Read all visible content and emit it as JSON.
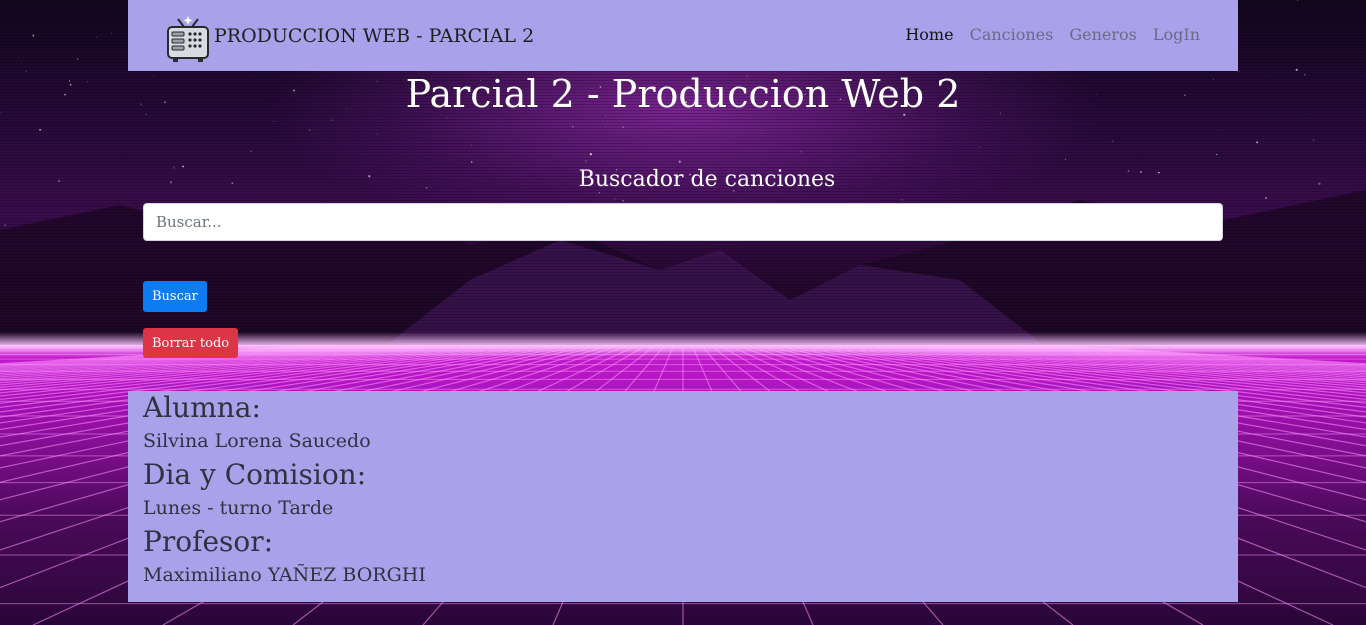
{
  "navbar": {
    "brand": "PRODUCCION WEB - PARCIAL 2",
    "logo_icon": "retro-tv-icon",
    "links": [
      {
        "label": "Home",
        "active": true
      },
      {
        "label": "Canciones",
        "active": false
      },
      {
        "label": "Generos",
        "active": false
      },
      {
        "label": "LogIn",
        "active": false
      }
    ]
  },
  "main": {
    "title": "Parcial 2 - Produccion Web 2"
  },
  "search": {
    "title": "Buscador de canciones",
    "placeholder": "Buscar...",
    "value": "",
    "search_button": "Buscar",
    "clear_button": "Borrar todo"
  },
  "info": {
    "student_label": "Alumna:",
    "student_value": "Silvina Lorena Saucedo",
    "day_label": "Dia y Comision:",
    "day_value": "Lunes - turno Tarde",
    "teacher_label": "Profesor:",
    "teacher_value": "Maximiliano YAÑEZ BORGHI"
  },
  "colors": {
    "panel": "#a9a1e9",
    "primary": "#0d7bf2",
    "danger": "#dc3545",
    "floor": "#c21ccb"
  }
}
